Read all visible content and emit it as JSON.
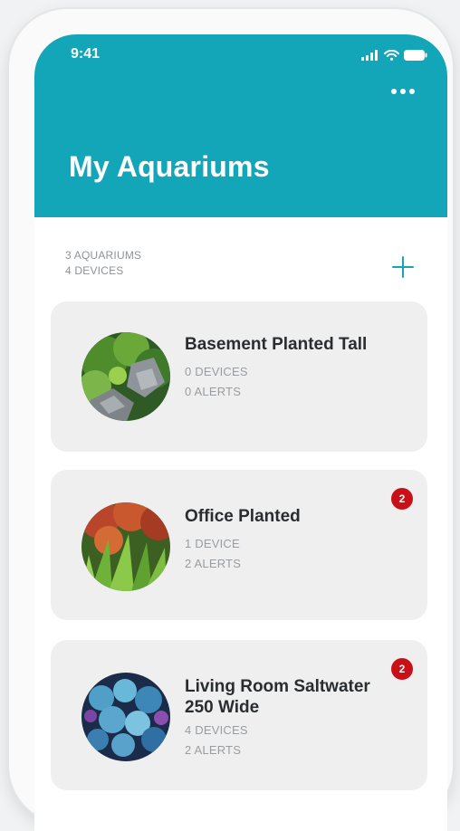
{
  "status_bar": {
    "time": "9:41"
  },
  "header": {
    "title": "My Aquariums"
  },
  "summary": {
    "aquariums": "3 AQUARIUMS",
    "devices": "4 DEVICES"
  },
  "colors": {
    "accent": "#13a6b8",
    "badge": "#c91018",
    "card": "#efefef"
  },
  "aquariums": [
    {
      "name": "Basement Planted Tall",
      "devices": "0 DEVICES",
      "alerts": "0 ALERTS",
      "badge": ""
    },
    {
      "name": "Office Planted",
      "devices": "1 DEVICE",
      "alerts": "2 ALERTS",
      "badge": "2"
    },
    {
      "name": "Living Room Saltwater 250 Wide",
      "devices": "4 DEVICES",
      "alerts": "2 ALERTS",
      "badge": "2"
    }
  ]
}
